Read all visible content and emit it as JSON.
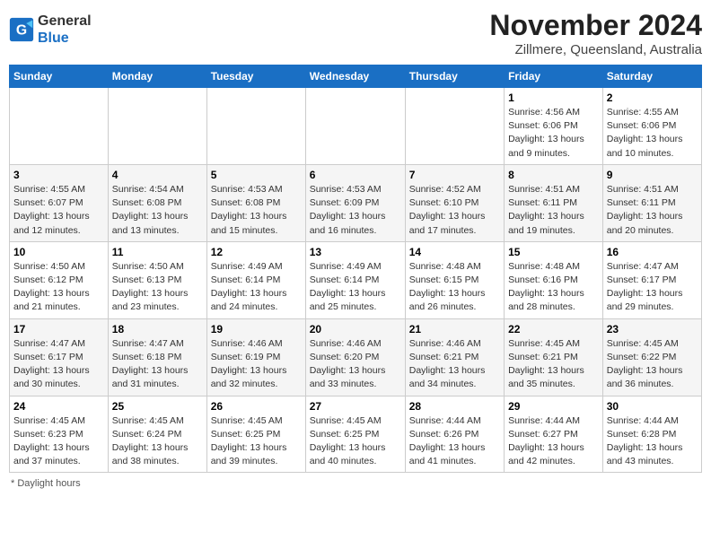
{
  "header": {
    "logo_general": "General",
    "logo_blue": "Blue",
    "month_year": "November 2024",
    "location": "Zillmere, Queensland, Australia"
  },
  "days_of_week": [
    "Sunday",
    "Monday",
    "Tuesday",
    "Wednesday",
    "Thursday",
    "Friday",
    "Saturday"
  ],
  "footer": {
    "note": "Daylight hours"
  },
  "weeks": [
    [
      {
        "num": "",
        "detail": ""
      },
      {
        "num": "",
        "detail": ""
      },
      {
        "num": "",
        "detail": ""
      },
      {
        "num": "",
        "detail": ""
      },
      {
        "num": "",
        "detail": ""
      },
      {
        "num": "1",
        "detail": "Sunrise: 4:56 AM\nSunset: 6:06 PM\nDaylight: 13 hours\nand 9 minutes."
      },
      {
        "num": "2",
        "detail": "Sunrise: 4:55 AM\nSunset: 6:06 PM\nDaylight: 13 hours\nand 10 minutes."
      }
    ],
    [
      {
        "num": "3",
        "detail": "Sunrise: 4:55 AM\nSunset: 6:07 PM\nDaylight: 13 hours\nand 12 minutes."
      },
      {
        "num": "4",
        "detail": "Sunrise: 4:54 AM\nSunset: 6:08 PM\nDaylight: 13 hours\nand 13 minutes."
      },
      {
        "num": "5",
        "detail": "Sunrise: 4:53 AM\nSunset: 6:08 PM\nDaylight: 13 hours\nand 15 minutes."
      },
      {
        "num": "6",
        "detail": "Sunrise: 4:53 AM\nSunset: 6:09 PM\nDaylight: 13 hours\nand 16 minutes."
      },
      {
        "num": "7",
        "detail": "Sunrise: 4:52 AM\nSunset: 6:10 PM\nDaylight: 13 hours\nand 17 minutes."
      },
      {
        "num": "8",
        "detail": "Sunrise: 4:51 AM\nSunset: 6:11 PM\nDaylight: 13 hours\nand 19 minutes."
      },
      {
        "num": "9",
        "detail": "Sunrise: 4:51 AM\nSunset: 6:11 PM\nDaylight: 13 hours\nand 20 minutes."
      }
    ],
    [
      {
        "num": "10",
        "detail": "Sunrise: 4:50 AM\nSunset: 6:12 PM\nDaylight: 13 hours\nand 21 minutes."
      },
      {
        "num": "11",
        "detail": "Sunrise: 4:50 AM\nSunset: 6:13 PM\nDaylight: 13 hours\nand 23 minutes."
      },
      {
        "num": "12",
        "detail": "Sunrise: 4:49 AM\nSunset: 6:14 PM\nDaylight: 13 hours\nand 24 minutes."
      },
      {
        "num": "13",
        "detail": "Sunrise: 4:49 AM\nSunset: 6:14 PM\nDaylight: 13 hours\nand 25 minutes."
      },
      {
        "num": "14",
        "detail": "Sunrise: 4:48 AM\nSunset: 6:15 PM\nDaylight: 13 hours\nand 26 minutes."
      },
      {
        "num": "15",
        "detail": "Sunrise: 4:48 AM\nSunset: 6:16 PM\nDaylight: 13 hours\nand 28 minutes."
      },
      {
        "num": "16",
        "detail": "Sunrise: 4:47 AM\nSunset: 6:17 PM\nDaylight: 13 hours\nand 29 minutes."
      }
    ],
    [
      {
        "num": "17",
        "detail": "Sunrise: 4:47 AM\nSunset: 6:17 PM\nDaylight: 13 hours\nand 30 minutes."
      },
      {
        "num": "18",
        "detail": "Sunrise: 4:47 AM\nSunset: 6:18 PM\nDaylight: 13 hours\nand 31 minutes."
      },
      {
        "num": "19",
        "detail": "Sunrise: 4:46 AM\nSunset: 6:19 PM\nDaylight: 13 hours\nand 32 minutes."
      },
      {
        "num": "20",
        "detail": "Sunrise: 4:46 AM\nSunset: 6:20 PM\nDaylight: 13 hours\nand 33 minutes."
      },
      {
        "num": "21",
        "detail": "Sunrise: 4:46 AM\nSunset: 6:21 PM\nDaylight: 13 hours\nand 34 minutes."
      },
      {
        "num": "22",
        "detail": "Sunrise: 4:45 AM\nSunset: 6:21 PM\nDaylight: 13 hours\nand 35 minutes."
      },
      {
        "num": "23",
        "detail": "Sunrise: 4:45 AM\nSunset: 6:22 PM\nDaylight: 13 hours\nand 36 minutes."
      }
    ],
    [
      {
        "num": "24",
        "detail": "Sunrise: 4:45 AM\nSunset: 6:23 PM\nDaylight: 13 hours\nand 37 minutes."
      },
      {
        "num": "25",
        "detail": "Sunrise: 4:45 AM\nSunset: 6:24 PM\nDaylight: 13 hours\nand 38 minutes."
      },
      {
        "num": "26",
        "detail": "Sunrise: 4:45 AM\nSunset: 6:25 PM\nDaylight: 13 hours\nand 39 minutes."
      },
      {
        "num": "27",
        "detail": "Sunrise: 4:45 AM\nSunset: 6:25 PM\nDaylight: 13 hours\nand 40 minutes."
      },
      {
        "num": "28",
        "detail": "Sunrise: 4:44 AM\nSunset: 6:26 PM\nDaylight: 13 hours\nand 41 minutes."
      },
      {
        "num": "29",
        "detail": "Sunrise: 4:44 AM\nSunset: 6:27 PM\nDaylight: 13 hours\nand 42 minutes."
      },
      {
        "num": "30",
        "detail": "Sunrise: 4:44 AM\nSunset: 6:28 PM\nDaylight: 13 hours\nand 43 minutes."
      }
    ]
  ]
}
